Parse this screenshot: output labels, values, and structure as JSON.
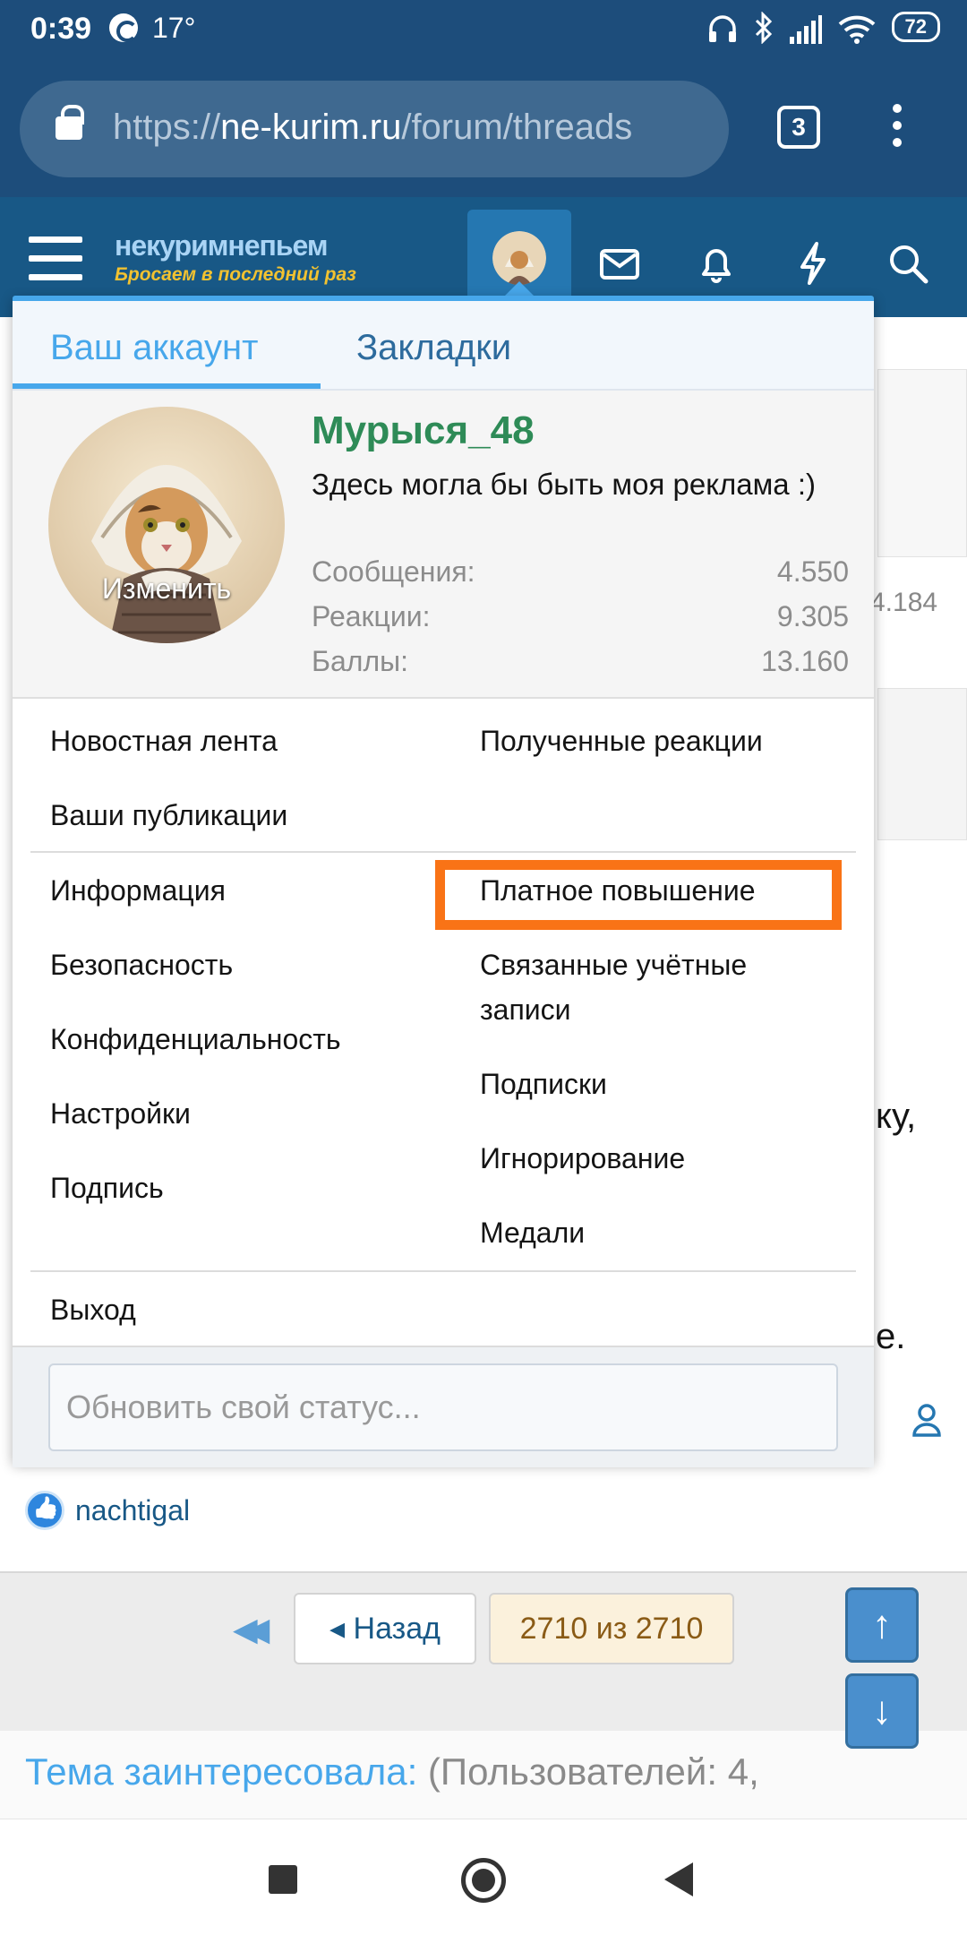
{
  "status_bar": {
    "time": "0:39",
    "temperature": "17°",
    "battery": "72"
  },
  "browser": {
    "url_scheme": "https://",
    "url_host": "ne-kurim.ru",
    "url_path": "/forum/threads",
    "tab_count": "3"
  },
  "site": {
    "logo_main": "некуримнепьем",
    "logo_sub": "Бросаем в последний раз"
  },
  "popup": {
    "tabs": [
      "Ваш аккаунт",
      "Закладки"
    ],
    "username": "Мурыся_48",
    "about": "Здесь могла бы быть моя реклама :)",
    "avatar_edit": "Изменить",
    "stats": [
      {
        "label": "Сообщения:",
        "value": "4.550"
      },
      {
        "label": "Реакции:",
        "value": "9.305"
      },
      {
        "label": "Баллы:",
        "value": "13.160"
      }
    ],
    "menu_left_1": [
      "Новостная лента",
      "Ваши публикации"
    ],
    "menu_right_1": [
      "Полученные реакции"
    ],
    "menu_left_2": [
      "Информация",
      "Безопасность",
      "Конфиденциальность",
      "Настройки",
      "Подпись"
    ],
    "menu_right_2": [
      "Платное повышение",
      "Связанные учётные записи",
      "Подписки",
      "Игнорирование",
      "Медали"
    ],
    "logout": "Выход",
    "status_placeholder": "Обновить свой статус...",
    "highlight_color": "#f97316"
  },
  "background": {
    "fragment_count": "4.184",
    "fragment_text_1": "ку,",
    "fragment_text_2": "е.",
    "reaction_user": "nachtigal",
    "pager_prev": "◂ Назад",
    "pager_count": "2710 из 2710",
    "interest_label": "Тема заинтересовала:",
    "interest_rest": "(Пользователей: 4,"
  },
  "colors": {
    "nav_bg": "#185886",
    "accent": "#47a7eb",
    "username": "#2e8b57"
  }
}
